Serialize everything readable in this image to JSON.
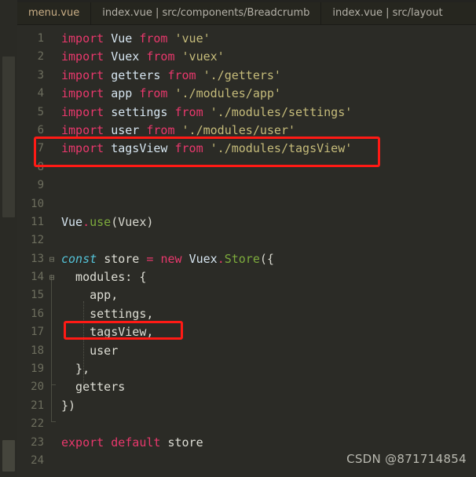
{
  "window": {
    "app": "code-editor",
    "theme_background": "#2b2b26",
    "accent_highlight": "#ff1a15"
  },
  "tabbar": {
    "tabs": [
      {
        "label": "menu.vue",
        "active": true
      },
      {
        "label": "index.vue | src/components/Breadcrumb",
        "active": false
      },
      {
        "label": "index.vue | src/layout",
        "active": false
      }
    ]
  },
  "editor": {
    "language": "javascript",
    "first_line": 1,
    "last_line": 24,
    "lines": [
      {
        "n": "1",
        "fold": "",
        "indent_guide": false
      },
      {
        "n": "2",
        "fold": "",
        "indent_guide": false
      },
      {
        "n": "3",
        "fold": "",
        "indent_guide": false
      },
      {
        "n": "4",
        "fold": "",
        "indent_guide": false
      },
      {
        "n": "5",
        "fold": "",
        "indent_guide": false
      },
      {
        "n": "6",
        "fold": "",
        "indent_guide": false
      },
      {
        "n": "7",
        "fold": "",
        "indent_guide": false
      },
      {
        "n": "8",
        "fold": "",
        "indent_guide": false
      },
      {
        "n": "9",
        "fold": "",
        "indent_guide": false
      },
      {
        "n": "10",
        "fold": "",
        "indent_guide": false
      },
      {
        "n": "11",
        "fold": "",
        "indent_guide": false
      },
      {
        "n": "12",
        "fold": "",
        "indent_guide": false
      },
      {
        "n": "13",
        "fold": "⊟",
        "indent_guide": false
      },
      {
        "n": "14",
        "fold": "⊟",
        "indent_guide": false
      },
      {
        "n": "15",
        "fold": "",
        "indent_guide": true
      },
      {
        "n": "16",
        "fold": "",
        "indent_guide": true
      },
      {
        "n": "17",
        "fold": "",
        "indent_guide": true
      },
      {
        "n": "18",
        "fold": "",
        "indent_guide": true
      },
      {
        "n": "19",
        "fold": "",
        "indent_guide": false
      },
      {
        "n": "20",
        "fold": "",
        "indent_guide": false
      },
      {
        "n": "21",
        "fold": "",
        "indent_guide": false
      },
      {
        "n": "22",
        "fold": "",
        "indent_guide": false
      },
      {
        "n": "23",
        "fold": "",
        "indent_guide": false
      },
      {
        "n": "24",
        "fold": "",
        "indent_guide": false
      }
    ],
    "code": {
      "l1": {
        "kw1": "import",
        "name": "Vue",
        "kw2": "from",
        "str": "'vue'"
      },
      "l2": {
        "kw1": "import",
        "name": "Vuex",
        "kw2": "from",
        "str": "'vuex'"
      },
      "l3": {
        "kw1": "import",
        "name": "getters",
        "kw2": "from",
        "str": "'./getters'"
      },
      "l4": {
        "kw1": "import",
        "name": "app",
        "kw2": "from",
        "str": "'./modules/app'"
      },
      "l5": {
        "kw1": "import",
        "name": "settings",
        "kw2": "from",
        "str": "'./modules/settings'"
      },
      "l6": {
        "kw1": "import",
        "name": "user",
        "kw2": "from",
        "str": "'./modules/user'"
      },
      "l7": {
        "kw1": "import",
        "name": "tagsView",
        "kw2": "from",
        "str": "'./modules/tagsView'"
      },
      "l11": {
        "obj": "Vue",
        "dot": ".",
        "fn": "use",
        "args": "(Vuex)"
      },
      "l13": {
        "kw_const": "const",
        "name": "store",
        "eq": "=",
        "kw_new": "new",
        "obj": "Vuex",
        "dot": ".",
        "fn": "Store",
        "tail": "({"
      },
      "l14": {
        "text": "  modules: {"
      },
      "l15": {
        "text": "    app,"
      },
      "l16": {
        "text": "    settings,"
      },
      "l17": {
        "text": "    tagsView,"
      },
      "l18": {
        "text": "    user"
      },
      "l19": {
        "text": "  },"
      },
      "l20": {
        "text": "  getters"
      },
      "l21": {
        "text": "})"
      },
      "l23": {
        "kw1": "export",
        "kw2": "default",
        "name": "store"
      }
    }
  },
  "annotations": [
    {
      "name": "highlight-import-tagsview",
      "target_line": "7",
      "color": "#ff1a15"
    },
    {
      "name": "highlight-module-tagsview",
      "target_line": "17",
      "color": "#ff1a15"
    }
  ],
  "watermark": {
    "text": "CSDN @871714854"
  }
}
